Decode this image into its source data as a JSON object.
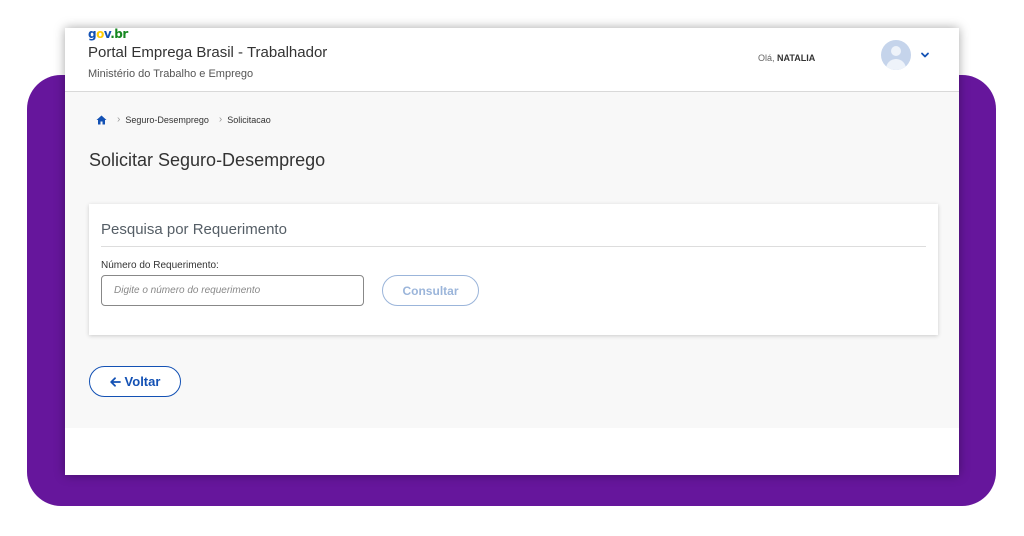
{
  "header": {
    "logo": {
      "g": "g",
      "o": "o",
      "v": "v",
      "dot": ".",
      "br": "br"
    },
    "portal_title": "Portal Emprega Brasil - Trabalhador",
    "ministry": "Ministério do Trabalho e Emprego",
    "greeting_prefix": "Olá,",
    "user_name": "NATALIA"
  },
  "breadcrumb": {
    "home_icon": "home-icon",
    "items": [
      "Seguro-Desemprego",
      "Solicitacao"
    ]
  },
  "page": {
    "title": "Solicitar Seguro-Desemprego"
  },
  "search_card": {
    "title": "Pesquisa por Requerimento",
    "field_label": "Número do Requerimento:",
    "input_placeholder": "Digite o número do requerimento",
    "input_value": "",
    "submit_label": "Consultar"
  },
  "back_button": {
    "label": "Voltar",
    "icon": "arrow-left-icon"
  },
  "colors": {
    "frame": "#66169c",
    "primary": "#1351b4",
    "disabled": "#9bb5da"
  }
}
